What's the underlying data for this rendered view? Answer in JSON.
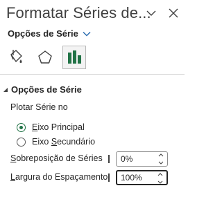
{
  "pane": {
    "title": "Formatar Séries de..."
  },
  "options_dropdown": {
    "label": "Opções de Série"
  },
  "tabs": [
    {
      "name": "Preenchimento e Linha",
      "icon": "paint-bucket-icon",
      "selected": false
    },
    {
      "name": "Efeitos",
      "icon": "pentagon-icon",
      "selected": false
    },
    {
      "name": "Opções de Série",
      "icon": "bar-chart-icon",
      "selected": true
    }
  ],
  "section": {
    "title": "Opções de Série",
    "plot_label": "Plotar Série no",
    "radio_primary": {
      "first": "E",
      "rest": "ixo Principal",
      "checked": true
    },
    "radio_secondary": {
      "prefix": "Eixo ",
      "first": "S",
      "rest": "ecundário",
      "checked": false
    },
    "overlap": {
      "first": "S",
      "rest": "obreposição de Séries",
      "value": "0%"
    },
    "gap": {
      "first": "L",
      "rest": "argura do Espaçamento",
      "value": "100%"
    }
  },
  "colors": {
    "accent_green": "#217346",
    "link_blue": "#2b6cb0"
  }
}
